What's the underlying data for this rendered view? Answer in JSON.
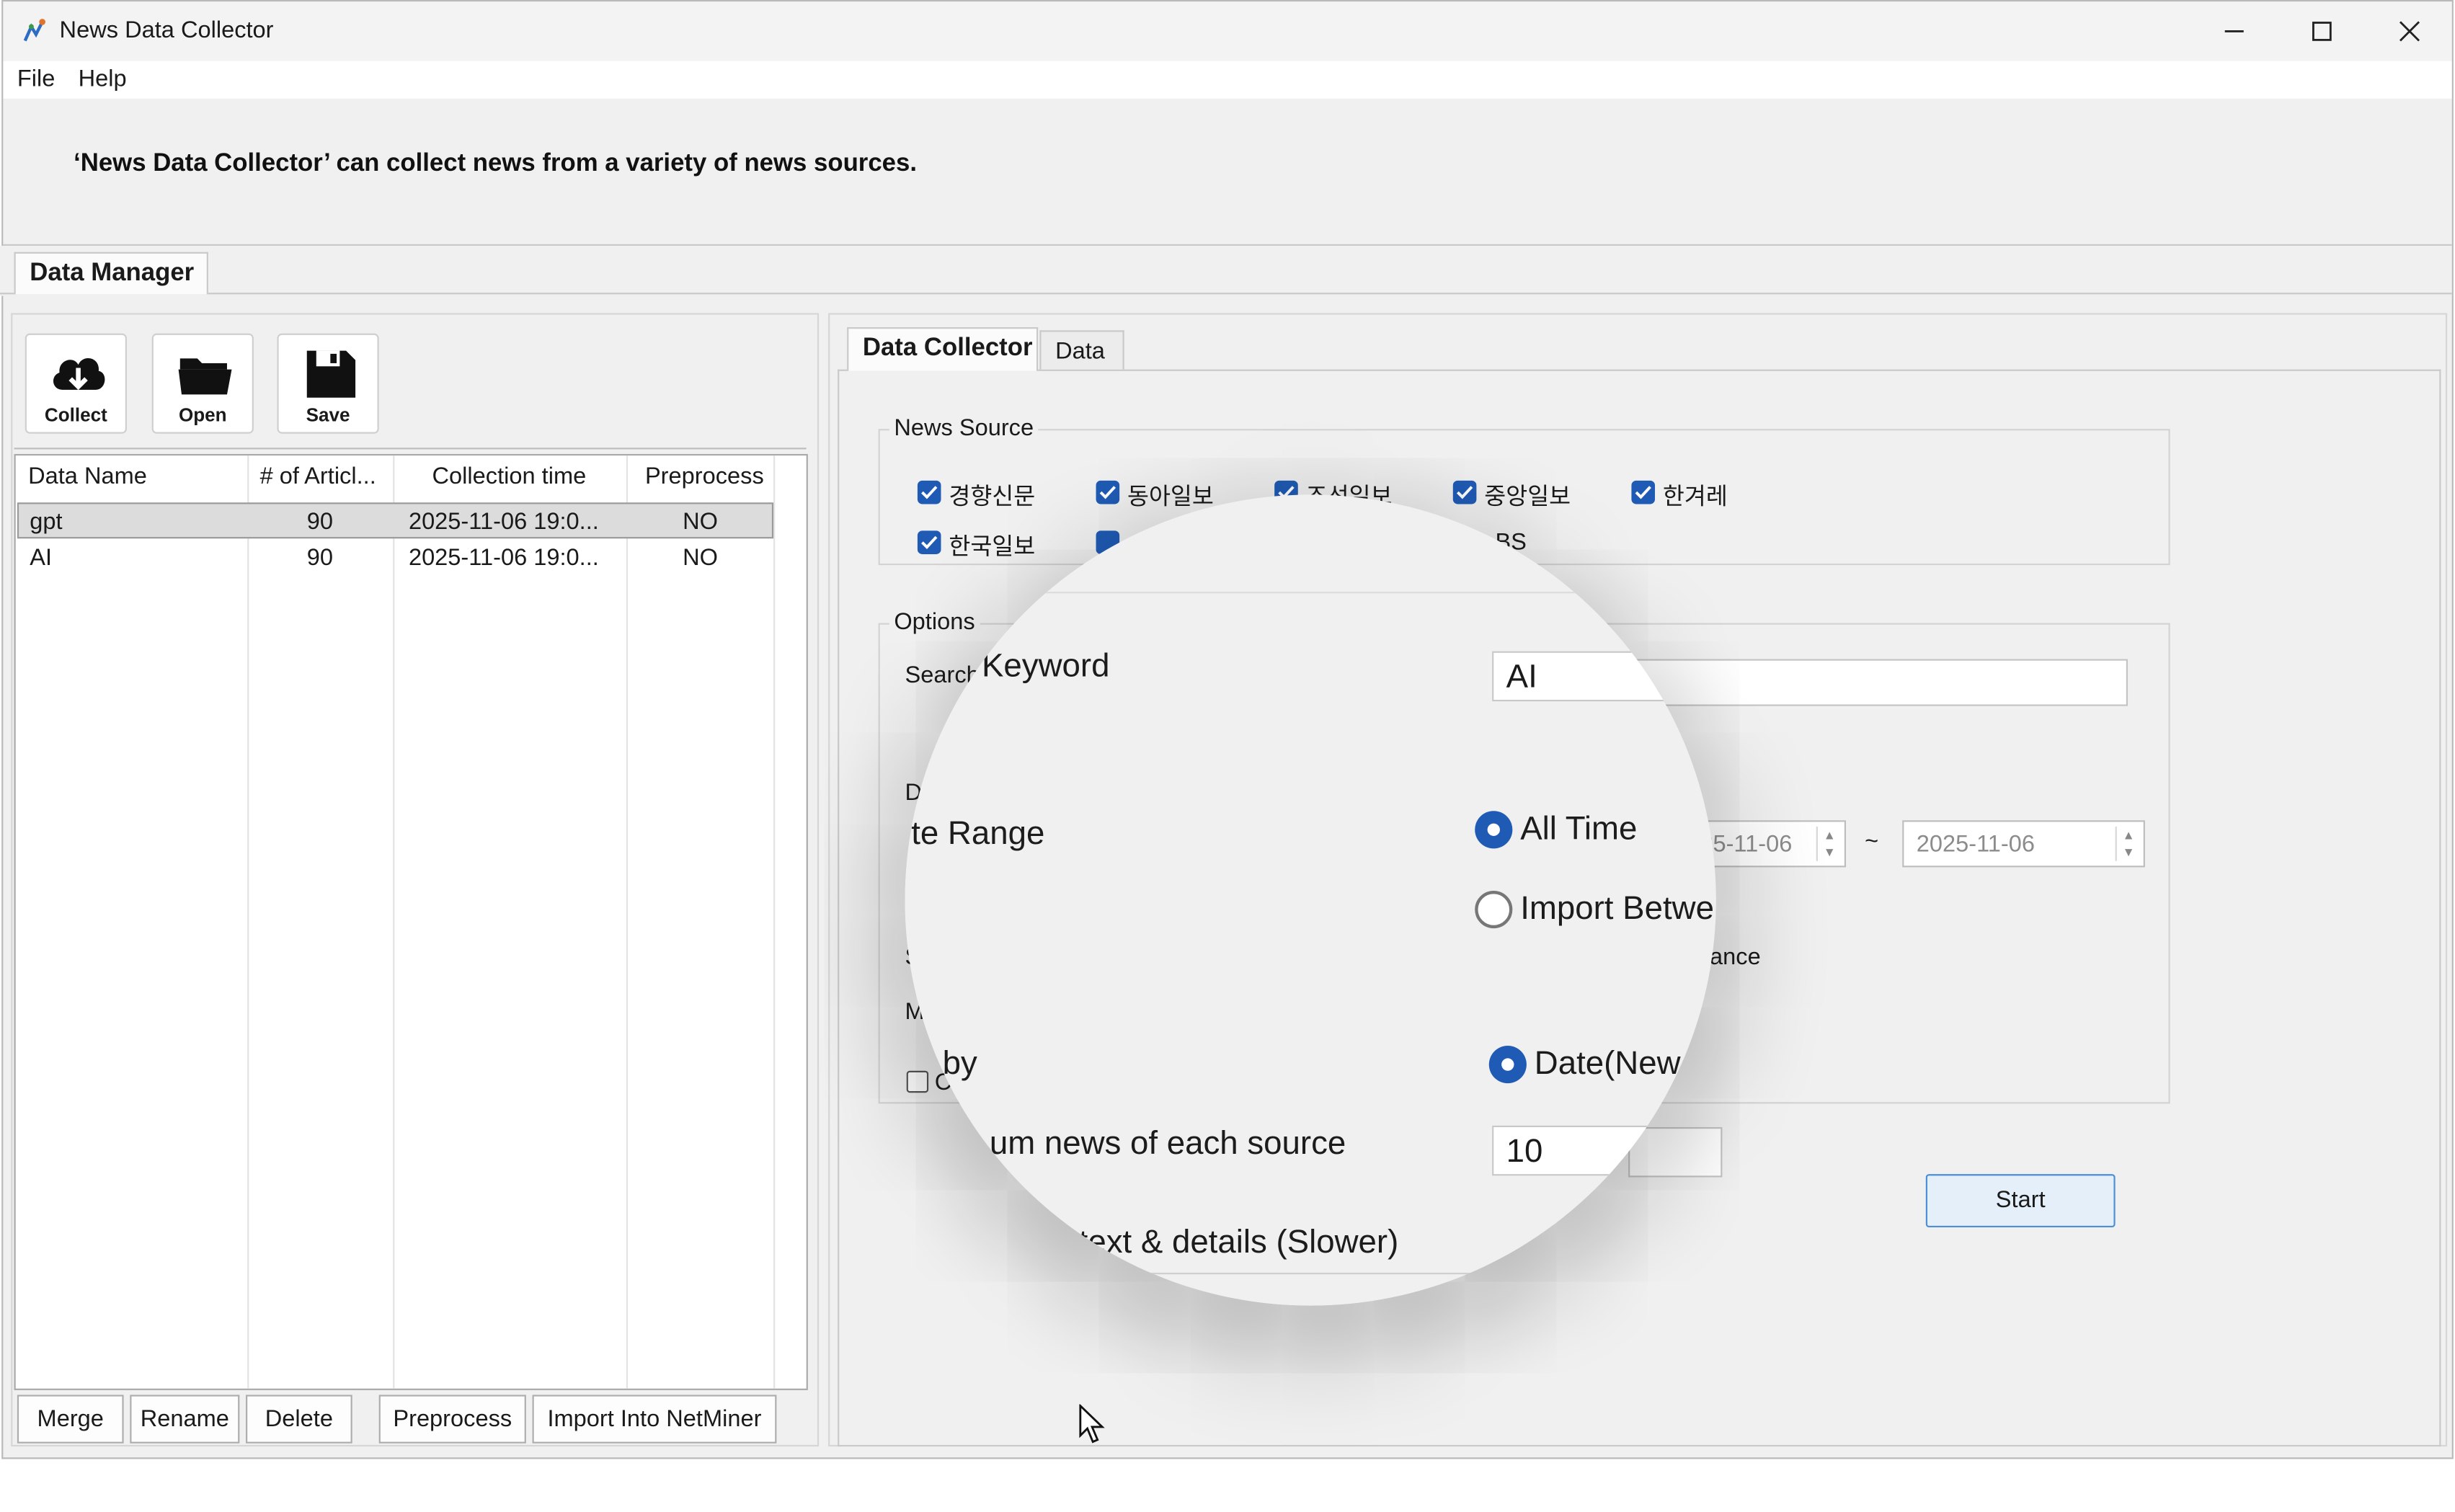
{
  "window": {
    "title": "News Data Collector",
    "controls": [
      "minimize",
      "maximize",
      "close"
    ]
  },
  "menu": {
    "items": [
      "File",
      "Help"
    ]
  },
  "banner": {
    "text": "‘News Data Collector’ can collect news from a variety of news sources."
  },
  "tabs": {
    "outer": "Data Manager",
    "inner": [
      "Data Collector",
      "Data"
    ]
  },
  "toolbar": {
    "collect": "Collect",
    "open": "Open",
    "save": "Save"
  },
  "grid": {
    "headers": [
      "Data Name",
      "# of Articl...",
      "Collection time",
      "Preprocess"
    ],
    "rows": [
      {
        "name": "gpt",
        "articles": "90",
        "time": "2025-11-06 19:0...",
        "preprocess": "NO",
        "selected": true
      },
      {
        "name": "AI",
        "articles": "90",
        "time": "2025-11-06 19:0...",
        "preprocess": "NO",
        "selected": false
      }
    ]
  },
  "bottom_buttons": [
    "Merge",
    "Rename",
    "Delete",
    "Preprocess",
    "Import Into NetMiner"
  ],
  "news_source": {
    "title": "News Source",
    "row1": [
      "경향신문",
      "동아일보",
      "조선일보",
      "중앙일보",
      "한겨레"
    ],
    "row2_visible": [
      "한국일보"
    ],
    "partial_suffix": "BS"
  },
  "options": {
    "title": "Options",
    "search_label_partial": "Search",
    "date_label_partial": "D",
    "s_label_partial": "S",
    "m_label_partial": "M",
    "checkbox_partial": "C",
    "date_from": "2025-11-06",
    "date_from_visible": "06",
    "date_separator": "~",
    "date_to": "2025-11-06",
    "relevance_partial": "ance",
    "start_button": "Start"
  },
  "magnifier": {
    "keyword_label": "Keyword",
    "keyword_value": "AI",
    "date_range_label": "te Range",
    "radio_all_time": "All Time",
    "radio_import_between": "Import Betwe",
    "sort_by_label": "by",
    "sort_option": "Date(New",
    "max_news_label": "um news of each source",
    "max_news_value": "10",
    "details_label": "text & details (Slower)"
  },
  "colors": {
    "accent": "#1f5bb5",
    "start_button_bg": "#e5effa",
    "start_button_border": "#4a8fd8",
    "selected_row": "#dcdcdc"
  }
}
